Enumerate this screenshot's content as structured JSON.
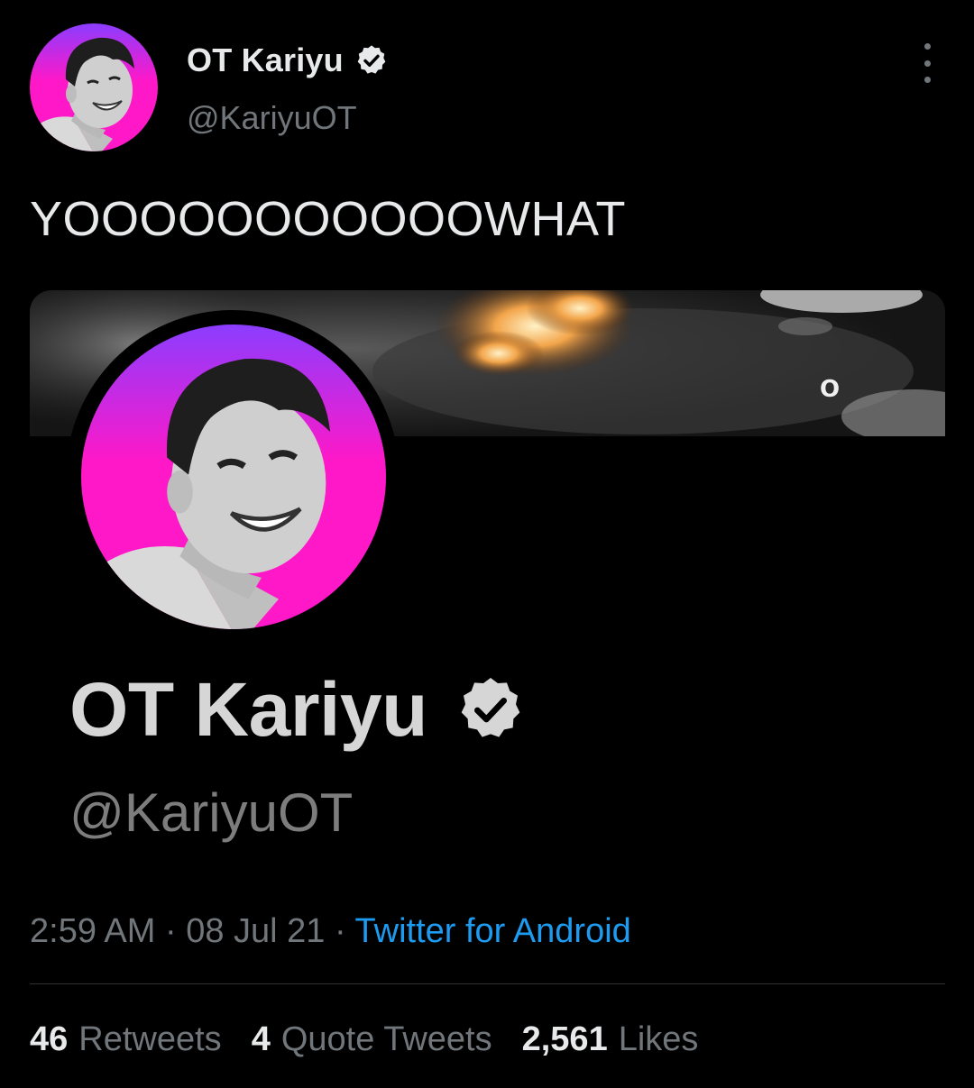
{
  "author": {
    "name": "OT Kariyu",
    "handle": "@KariyuOT",
    "verified": true
  },
  "tweet": {
    "text": "YOOOOOOOOOOOWHAT"
  },
  "media": {
    "banner_text": "O",
    "profile": {
      "name": "OT Kariyu",
      "handle": "@KariyuOT",
      "verified": true
    }
  },
  "meta": {
    "time": "2:59 AM",
    "separator": "·",
    "date": "08 Jul 21",
    "source": "Twitter for Android"
  },
  "stats": [
    {
      "count": "46",
      "label": "Retweets"
    },
    {
      "count": "4",
      "label": "Quote Tweets"
    },
    {
      "count": "2,561",
      "label": "Likes"
    }
  ],
  "icons": {
    "more": "more-vertical-icon",
    "verified": "verified-badge-icon"
  },
  "colors": {
    "background": "#000000",
    "text_primary": "#e7e9ea",
    "text_secondary": "#71767b",
    "link": "#1d9bf0",
    "avatar_gradient_top": "#8b3dff",
    "avatar_gradient_bottom": "#ff18c8"
  }
}
